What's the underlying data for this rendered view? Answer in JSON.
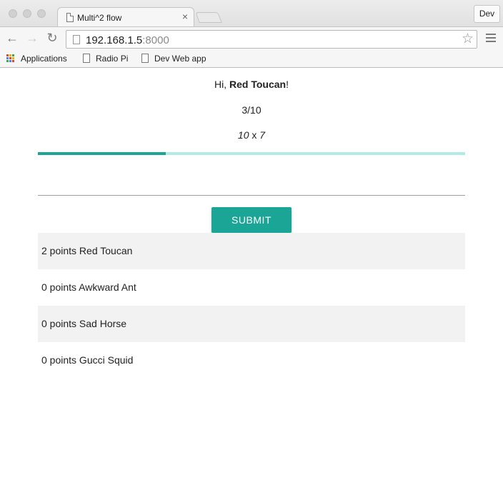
{
  "browser": {
    "tab_title": "Multi^2 flow",
    "tab_close": "×",
    "profile_button": "Dev",
    "nav": {
      "back": "←",
      "forward": "→",
      "reload": "↻"
    },
    "url_host": "192.168.1.5",
    "url_port": ":8000",
    "star_icon": "☆",
    "bookmarks": [
      {
        "label": "Applications",
        "icon": "apps-grid-icon"
      },
      {
        "label": "Radio Pi",
        "icon": "page-icon"
      },
      {
        "label": "Dev Web app",
        "icon": "page-icon"
      }
    ]
  },
  "game": {
    "greeting_prefix": "Hi, ",
    "player_name": "Red Toucan",
    "greeting_suffix": "!",
    "progress_text": "3/10",
    "progress_fraction": 0.3,
    "question_a": "10",
    "question_op": " x ",
    "question_b": "7",
    "answer_value": "",
    "submit_label": "SUBMIT",
    "accent_color": "#1aa596",
    "track_color": "#b2ebe5"
  },
  "scoreboard": [
    {
      "text": "2 points Red Toucan"
    },
    {
      "text": "0 points Awkward Ant"
    },
    {
      "text": "0 points Sad Horse"
    },
    {
      "text": "0 points Gucci Squid"
    }
  ]
}
